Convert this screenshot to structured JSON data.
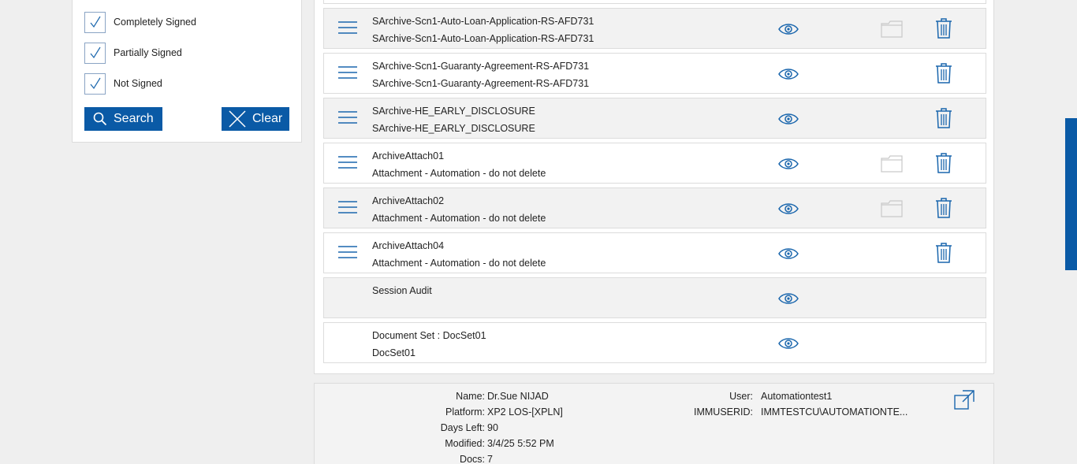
{
  "filters": {
    "options": [
      {
        "label": "Completely Signed",
        "checked": true
      },
      {
        "label": "Partially Signed",
        "checked": true
      },
      {
        "label": "Not Signed",
        "checked": true
      }
    ],
    "search_label": "Search",
    "clear_label": "Clear"
  },
  "documents": [
    {
      "line1": "SArchive-Scn1-Auto-Loan-Application-RS-AFD731",
      "line2": "SArchive-Scn1-Auto-Loan-Application-RS-AFD731",
      "draggable": true,
      "folder": true,
      "delete": true
    },
    {
      "line1": "SArchive-Scn1-Guaranty-Agreement-RS-AFD731",
      "line2": "SArchive-Scn1-Guaranty-Agreement-RS-AFD731",
      "draggable": true,
      "folder": false,
      "delete": true
    },
    {
      "line1": "SArchive-HE_EARLY_DISCLOSURE",
      "line2": "SArchive-HE_EARLY_DISCLOSURE",
      "draggable": true,
      "folder": false,
      "delete": true
    },
    {
      "line1": "ArchiveAttach01",
      "line2": "Attachment - Automation - do not delete",
      "draggable": true,
      "folder": true,
      "delete": true
    },
    {
      "line1": "ArchiveAttach02",
      "line2": "Attachment - Automation - do not delete",
      "draggable": true,
      "folder": true,
      "delete": true
    },
    {
      "line1": "ArchiveAttach04",
      "line2": "Attachment - Automation - do not delete",
      "draggable": true,
      "folder": false,
      "delete": true
    },
    {
      "line1": "Session Audit",
      "line2": "",
      "draggable": false,
      "folder": false,
      "delete": false
    },
    {
      "line1": "Document Set : DocSet01",
      "line2": "DocSet01",
      "draggable": false,
      "folder": false,
      "delete": false
    }
  ],
  "info": {
    "left": [
      {
        "key": "Name:",
        "value": "Dr.Sue NIJAD"
      },
      {
        "key": "Platform:",
        "value": "XP2 LOS-[XPLN]"
      },
      {
        "key": "Days Left:",
        "value": "90"
      },
      {
        "key": "Modified:",
        "value": "3/4/25 5:52 PM"
      },
      {
        "key": "Docs:",
        "value": "7"
      }
    ],
    "right": [
      {
        "key": "User:",
        "value": "Automationtest1"
      },
      {
        "key": "IMMUSERID:",
        "value": "IMMTESTCU\\AUTOMATIONTE..."
      }
    ]
  },
  "colors": {
    "accent": "#0a5aa6",
    "icon": "#1a66ad",
    "folder": "#c9c9c9"
  }
}
